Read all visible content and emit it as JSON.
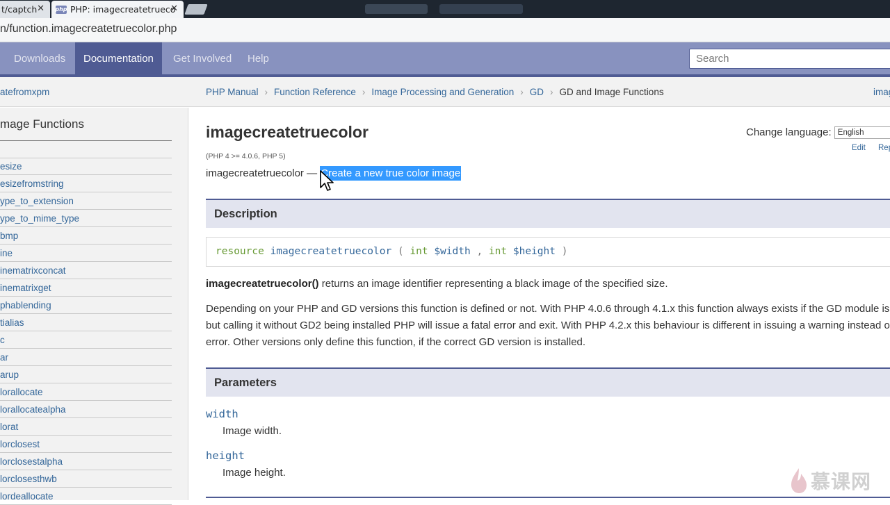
{
  "browser": {
    "tabs": [
      {
        "label": "t/captch"
      },
      {
        "label": "PHP: imagecreatetrueco"
      }
    ],
    "favicon_text": "php",
    "url": "n/function.imagecreatetruecolor.php"
  },
  "nav": {
    "items": [
      "Downloads",
      "Documentation",
      "Get Involved",
      "Help"
    ],
    "active": "Documentation",
    "search_placeholder": "Search"
  },
  "breadcrumb": {
    "prev": "atefromxpm",
    "trail": [
      "PHP Manual",
      "Function Reference",
      "Image Processing and Generation",
      "GD",
      "GD and Image Functions"
    ],
    "separator": "›",
    "next": "imag"
  },
  "sidebar": {
    "title": "mage Functions",
    "items": [
      "esize",
      "esizefromstring",
      "ype_to_extension",
      "ype_to_mime_type",
      "bmp",
      "ine",
      "inematrixconcat",
      "inematrixget",
      "phablending",
      "tialias",
      "c",
      "ar",
      "arup",
      "lorallocate",
      "lorallocatealpha",
      "lorat",
      "lorclosest",
      "lorclosestalpha",
      "lorclosesthwb",
      "lordeallocate"
    ]
  },
  "main": {
    "title": "imagecreatetruecolor",
    "version": "(PHP 4 >= 4.0.6, PHP 5)",
    "refname": "imagecreatetruecolor",
    "dash": " — ",
    "refpurpose": "Create a new true color image",
    "change_language_label": "Change language:",
    "language": "English",
    "edit": "Edit",
    "report": "Rep",
    "description_heading": "Description",
    "signature": {
      "return_type": "resource",
      "func": "imagecreatetruecolor",
      "open": "(",
      "p1_type": "int",
      "p1_name": "$width",
      "comma": ",",
      "p2_type": "int",
      "p2_name": "$height",
      "close": ")"
    },
    "returns_func": "imagecreatetruecolor()",
    "returns_text": " returns an image identifier representing a black image of the specified size.",
    "para2_lines": [
      "Depending on your PHP and GD versions this function is defined or not. With PHP 4.0.6 through 4.1.x this function always exists if the GD module is lo",
      "but calling it without GD2 being installed PHP will issue a fatal error and exit. With PHP 4.2.x this behaviour is different in issuing a warning instead of",
      "error. Other versions only define this function, if the correct GD version is installed."
    ],
    "parameters_heading": "Parameters",
    "params": [
      {
        "name": "width",
        "desc": "Image width."
      },
      {
        "name": "height",
        "desc": "Image height."
      }
    ]
  },
  "watermark": {
    "text": "慕课网"
  },
  "colors": {
    "nav_bg": "#8892bf",
    "nav_active": "#4f5b93",
    "link": "#336699",
    "selection": "#3399ff",
    "section_bg": "#e2e4ef"
  }
}
